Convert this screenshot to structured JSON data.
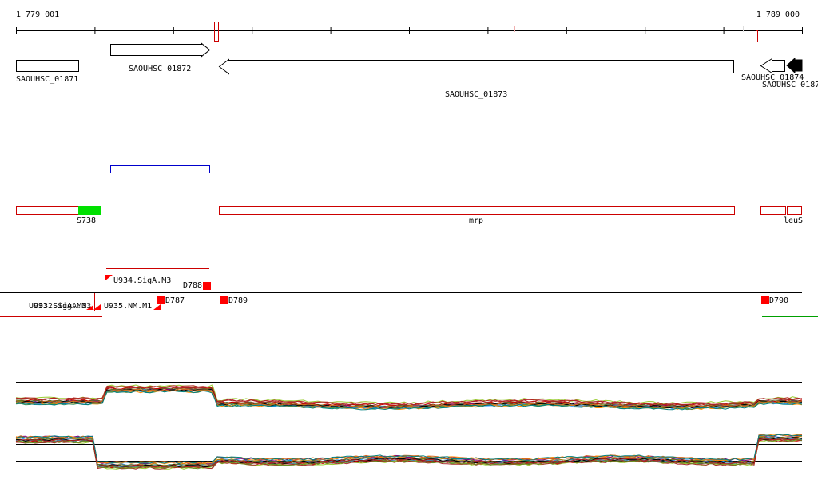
{
  "coords": {
    "start": "1 779 001",
    "end": "1 789 000"
  },
  "genes": [
    {
      "id": "SAOUHSC_01871",
      "strand": "none"
    },
    {
      "id": "SAOUHSC_01872",
      "strand": "+"
    },
    {
      "id": "SAOUHSC_01873",
      "strand": "-"
    },
    {
      "id": "SAOUHSC_01874",
      "strand": "-"
    },
    {
      "id": "SAOUHSC_0187",
      "strand": "-",
      "filled": true
    }
  ],
  "features": [
    {
      "id": "S738",
      "color": "#00e000"
    },
    {
      "id": "mrp",
      "color": "#cc0000"
    },
    {
      "id": "leuS",
      "color": "#cc0000"
    }
  ],
  "promoters": [
    "U934.SigA.M3",
    "U935.NM.M1",
    "U933.SigA.M3",
    "U932.SigA.M3"
  ],
  "terminators": [
    "D787",
    "D788",
    "D789",
    "D790"
  ],
  "colors": {
    "gene_outline": "#000000",
    "feature_outline": "#cc0000",
    "segment_outline": "#0000cc",
    "promoter": "#ff0000",
    "terminator": "#ff0000",
    "green_line": "#00a000"
  }
}
